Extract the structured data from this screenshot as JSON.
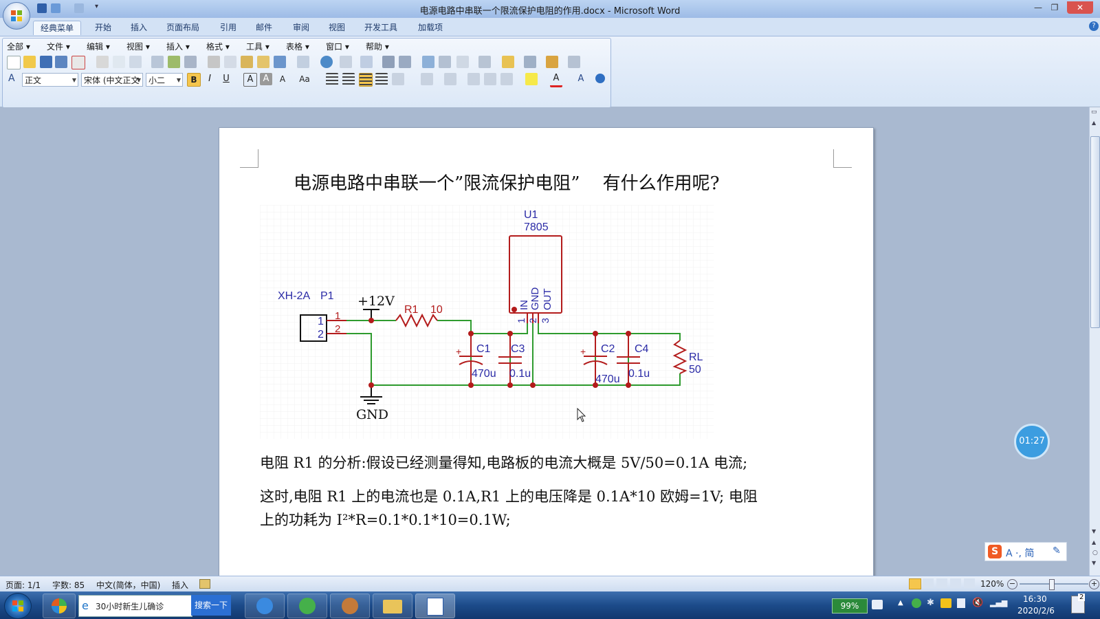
{
  "window": {
    "title": "电源电路中串联一个限流保护电阻的作用.docx - Microsoft Word"
  },
  "ribbon_tabs": [
    "经典菜单",
    "开始",
    "插入",
    "页面布局",
    "引用",
    "邮件",
    "审阅",
    "视图",
    "开发工具",
    "加载项"
  ],
  "classic_menu": [
    "全部",
    "文件",
    "编辑",
    "视图",
    "插入",
    "格式",
    "工具",
    "表格",
    "窗口",
    "帮助"
  ],
  "format_bar": {
    "style": "正文",
    "font": "宋体 (中文正文",
    "size": "小二"
  },
  "document": {
    "title": "电源电路中串联一个”限流保护电阻”    有什么作用呢?",
    "paragraphs": [
      "电阻 R1 的分析:假设已经测量得知,电路板的电流大概是 5V/50=0.1A 电流;",
      "这时,电阻 R1 上的电流也是 0.1A,R1 上的电压降是 0.1A*10 欧姆=1V; 电阻",
      "上的功耗为 I²*R=0.1*0.1*10=0.1W;"
    ]
  },
  "schematic": {
    "connector": {
      "model": "XH-2A",
      "ref": "P1",
      "pin1": "1",
      "pin2": "2",
      "wire1": "1",
      "wire2": "2"
    },
    "supply": "+12V",
    "r1": {
      "ref": "R1",
      "value": "10"
    },
    "u1": {
      "ref": "U1",
      "part": "7805",
      "pin_in": "IN",
      "pin_gnd": "GND",
      "pin_out": "OUT",
      "pin1": "1",
      "pin2": "2",
      "pin3": "3"
    },
    "c1": {
      "ref": "C1",
      "value": "470u"
    },
    "c3": {
      "ref": "C3",
      "value": "0.1u"
    },
    "c2": {
      "ref": "C2",
      "value": "470u"
    },
    "c4": {
      "ref": "C4",
      "value": "0.1u"
    },
    "rl": {
      "ref": "RL",
      "value": "50"
    },
    "ground": "GND"
  },
  "status": {
    "page": "页面: 1/1",
    "words": "字数: 85",
    "language": "中文(简体，中国)",
    "mode": "插入",
    "zoom": "120%"
  },
  "overlay": {
    "timer": "01:27",
    "ime_text": "A ·, 简"
  },
  "taskbar": {
    "browser_tab": "30小时新生儿确诊",
    "search_btn": "搜索一下",
    "battery": "99%",
    "time": "16:30",
    "date": "2020/2/6",
    "badge": "2"
  },
  "colors": {
    "wire": "#2e9b2e",
    "component": "#b31b1b",
    "label": "#2a2aa6"
  }
}
